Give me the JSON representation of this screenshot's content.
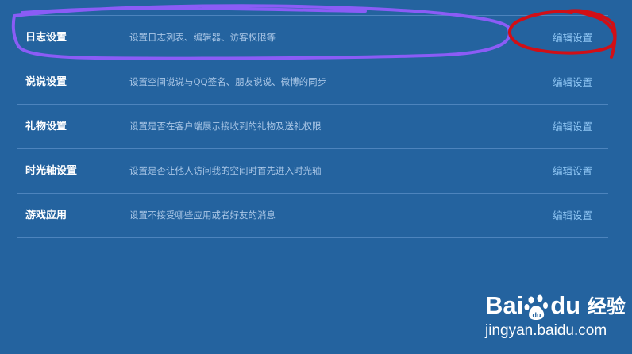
{
  "settings": [
    {
      "title": "日志设置",
      "description": "设置日志列表、编辑器、访客权限等",
      "action": "编辑设置"
    },
    {
      "title": "说说设置",
      "description": "设置空间说说与QQ签名、朋友说说、微博的同步",
      "action": "编辑设置"
    },
    {
      "title": "礼物设置",
      "description": "设置是否在客户端展示接收到的礼物及送礼权限",
      "action": "编辑设置"
    },
    {
      "title": "时光轴设置",
      "description": "设置是否让他人访问我的空间时首先进入时光轴",
      "action": "编辑设置"
    },
    {
      "title": "游戏应用",
      "description": "设置不接受哪些应用或者好友的消息",
      "action": "编辑设置"
    }
  ],
  "watermark": {
    "brand_prefix": "Bai",
    "brand_suffix": "du",
    "product": "经验",
    "url": "jingyan.baidu.com"
  },
  "colors": {
    "background": "#24639f",
    "divider": "#4d84bd",
    "title": "#ffffff",
    "description": "#a9c6e6",
    "link": "#8fc6f4",
    "highlight_purple": "#8b5cf6",
    "highlight_red": "#d10f16"
  }
}
